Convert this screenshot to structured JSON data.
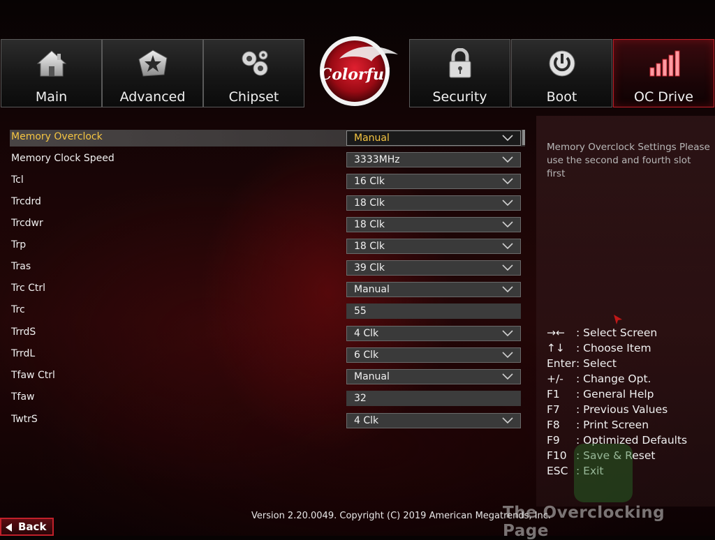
{
  "tabs": [
    {
      "label": "Main",
      "icon": "home-icon"
    },
    {
      "label": "Advanced",
      "icon": "star-icon"
    },
    {
      "label": "Chipset",
      "icon": "gears-icon"
    },
    {
      "label": "Security",
      "icon": "lock-icon"
    },
    {
      "label": "Boot",
      "icon": "power-icon"
    },
    {
      "label": "OC Drive",
      "icon": "bars-icon",
      "active": true
    }
  ],
  "logo": {
    "text": "Colorful"
  },
  "settings": [
    {
      "label": "Memory Overclock",
      "value": "Manual",
      "type": "dropdown",
      "selected": true
    },
    {
      "label": "Memory Clock Speed",
      "value": "3333MHz",
      "type": "dropdown"
    },
    {
      "label": "Tcl",
      "value": "16 Clk",
      "type": "dropdown"
    },
    {
      "label": "Trcdrd",
      "value": "18 Clk",
      "type": "dropdown"
    },
    {
      "label": "Trcdwr",
      "value": "18 Clk",
      "type": "dropdown"
    },
    {
      "label": "Trp",
      "value": "18 Clk",
      "type": "dropdown"
    },
    {
      "label": "Tras",
      "value": "39 Clk",
      "type": "dropdown"
    },
    {
      "label": "Trc Ctrl",
      "value": "Manual",
      "type": "dropdown"
    },
    {
      "label": "Trc",
      "value": "55",
      "type": "text"
    },
    {
      "label": "TrrdS",
      "value": "4 Clk",
      "type": "dropdown"
    },
    {
      "label": "TrrdL",
      "value": "6 Clk",
      "type": "dropdown"
    },
    {
      "label": "Tfaw Ctrl",
      "value": "Manual",
      "type": "dropdown"
    },
    {
      "label": "Tfaw",
      "value": "32",
      "type": "text"
    },
    {
      "label": "TwtrS",
      "value": "4 Clk",
      "type": "dropdown"
    }
  ],
  "help": {
    "description": "Memory Overclock Settings Please use the second and fourth slot first"
  },
  "keys": [
    {
      "key": "→←",
      "desc": ": Select Screen"
    },
    {
      "key": "↑↓",
      "desc": ": Choose Item"
    },
    {
      "key": "Enter",
      "desc": ": Select"
    },
    {
      "key": "+/-",
      "desc": ": Change Opt."
    },
    {
      "key": "F1",
      "desc": ": General Help"
    },
    {
      "key": "F7",
      "desc": ": Previous Values"
    },
    {
      "key": "F8",
      "desc": ": Print Screen"
    },
    {
      "key": "F9",
      "desc": ": Optimized Defaults"
    },
    {
      "key": "F10",
      "desc": ": Save & Reset"
    },
    {
      "key": "ESC",
      "desc": ": Exit"
    }
  ],
  "footer": {
    "version": "Version 2.20.0049. Copyright (C) 2019 American Megatrends, Inc.",
    "watermark": "The Overclocking Page",
    "back_label": "Back"
  },
  "colors": {
    "accent_red": "#c0202a",
    "selected_text": "#f5c542"
  }
}
